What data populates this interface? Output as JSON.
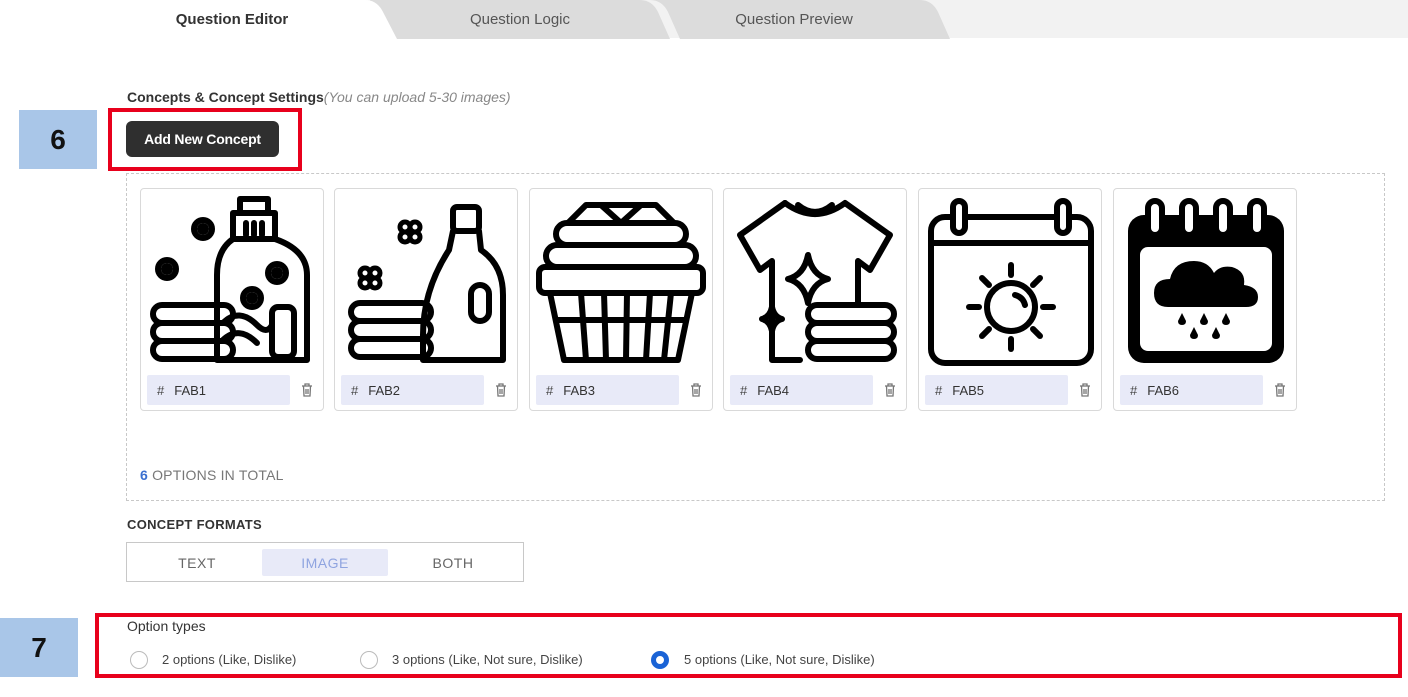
{
  "tabs": [
    {
      "label": "Question Editor",
      "active": true
    },
    {
      "label": "Question Logic",
      "active": false
    },
    {
      "label": "Question Preview",
      "active": false
    }
  ],
  "concepts_section": {
    "title": "Concepts & Concept Settings",
    "hint": "(You can upload 5-30 images)",
    "add_button": "Add New Concept"
  },
  "annotations": {
    "badge_6": "6",
    "badge_7": "7"
  },
  "concepts": [
    {
      "label": "FAB1",
      "icon": "softener-flowers-towels-icon"
    },
    {
      "label": "FAB2",
      "icon": "detergent-bottle-towels-icon"
    },
    {
      "label": "FAB3",
      "icon": "laundry-basket-icon"
    },
    {
      "label": "FAB4",
      "icon": "clean-shirt-sparkle-icon"
    },
    {
      "label": "FAB5",
      "icon": "calendar-sun-icon"
    },
    {
      "label": "FAB6",
      "icon": "calendar-rain-icon"
    }
  ],
  "totals": {
    "count": "6",
    "text": " OPTIONS IN TOTAL"
  },
  "formats": {
    "label": "CONCEPT FORMATS",
    "options": [
      "TEXT",
      "IMAGE",
      "BOTH"
    ],
    "selected": "IMAGE"
  },
  "option_types": {
    "label": "Option types",
    "options": [
      {
        "label": "2 options (Like, Dislike)",
        "selected": false
      },
      {
        "label": "3 options (Like, Not sure, Dislike)",
        "selected": false
      },
      {
        "label": "5 options (Like, Not sure, Dislike)",
        "selected": true
      }
    ]
  },
  "colors": {
    "accent": "#1a63d6",
    "annotation_red": "#e8001c",
    "badge_blue": "#a9c6e8",
    "chip_bg": "#e8eaf8"
  }
}
